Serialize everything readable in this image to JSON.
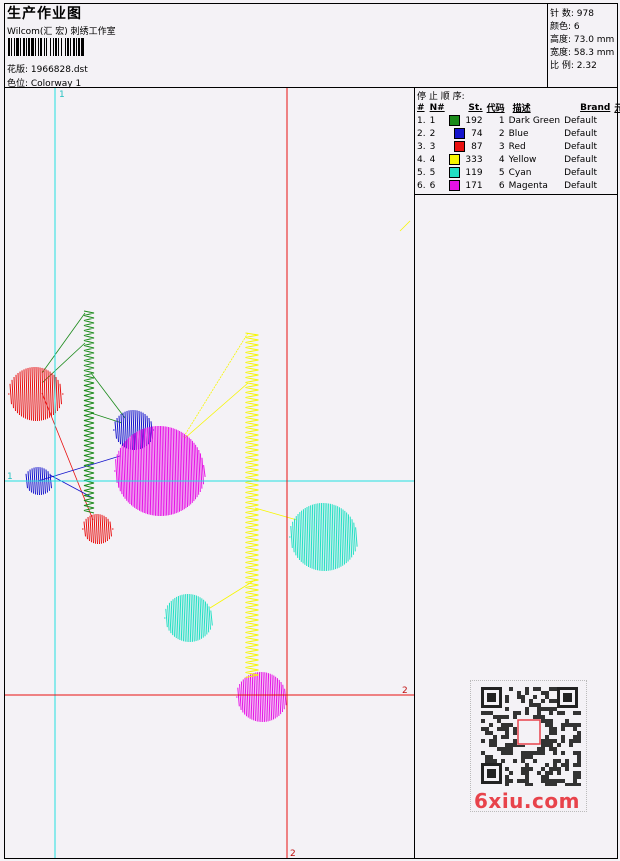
{
  "header": {
    "title": "生产作业图",
    "company": "Wilcom(汇 宏) 刺绣工作室",
    "design_label": "花版: 1966828.dst",
    "colorway_label": "色位: Colorway 1"
  },
  "stats": [
    {
      "label": "针 数: 978"
    },
    {
      "label": "颜色: 6"
    },
    {
      "label": "高度: 73.0 mm"
    },
    {
      "label": "宽度: 58.3 mm"
    },
    {
      "label": "比 例: 2.32"
    }
  ],
  "color_sheet": {
    "title": "停 止 顺 序:",
    "columns": [
      "#",
      "N#",
      "St.",
      "代码",
      "描述",
      "Brand",
      "元素"
    ],
    "rows": [
      {
        "idx": "1.",
        "n": "1",
        "color": "#1a8a1a",
        "stitches": "192",
        "code": "1",
        "desc": "Dark Green",
        "brand": "Default"
      },
      {
        "idx": "2.",
        "n": "2",
        "color": "#1414cc",
        "stitches": "74",
        "code": "2",
        "desc": "Blue",
        "brand": "Default"
      },
      {
        "idx": "3.",
        "n": "3",
        "color": "#e81010",
        "stitches": "87",
        "code": "3",
        "desc": "Red",
        "brand": "Default"
      },
      {
        "idx": "4.",
        "n": "4",
        "color": "#f7f700",
        "stitches": "333",
        "code": "4",
        "desc": "Yellow",
        "brand": "Default"
      },
      {
        "idx": "5.",
        "n": "5",
        "color": "#22e0c4",
        "stitches": "119",
        "code": "5",
        "desc": "Cyan",
        "brand": "Default"
      },
      {
        "idx": "6.",
        "n": "6",
        "color": "#e612e6",
        "stitches": "171",
        "code": "6",
        "desc": "Magenta",
        "brand": "Default"
      }
    ]
  },
  "axes": {
    "cyan_v": "1",
    "cyan_h": "1",
    "red_h": "2",
    "red_v": "2"
  },
  "watermark": "6xiu.com"
}
